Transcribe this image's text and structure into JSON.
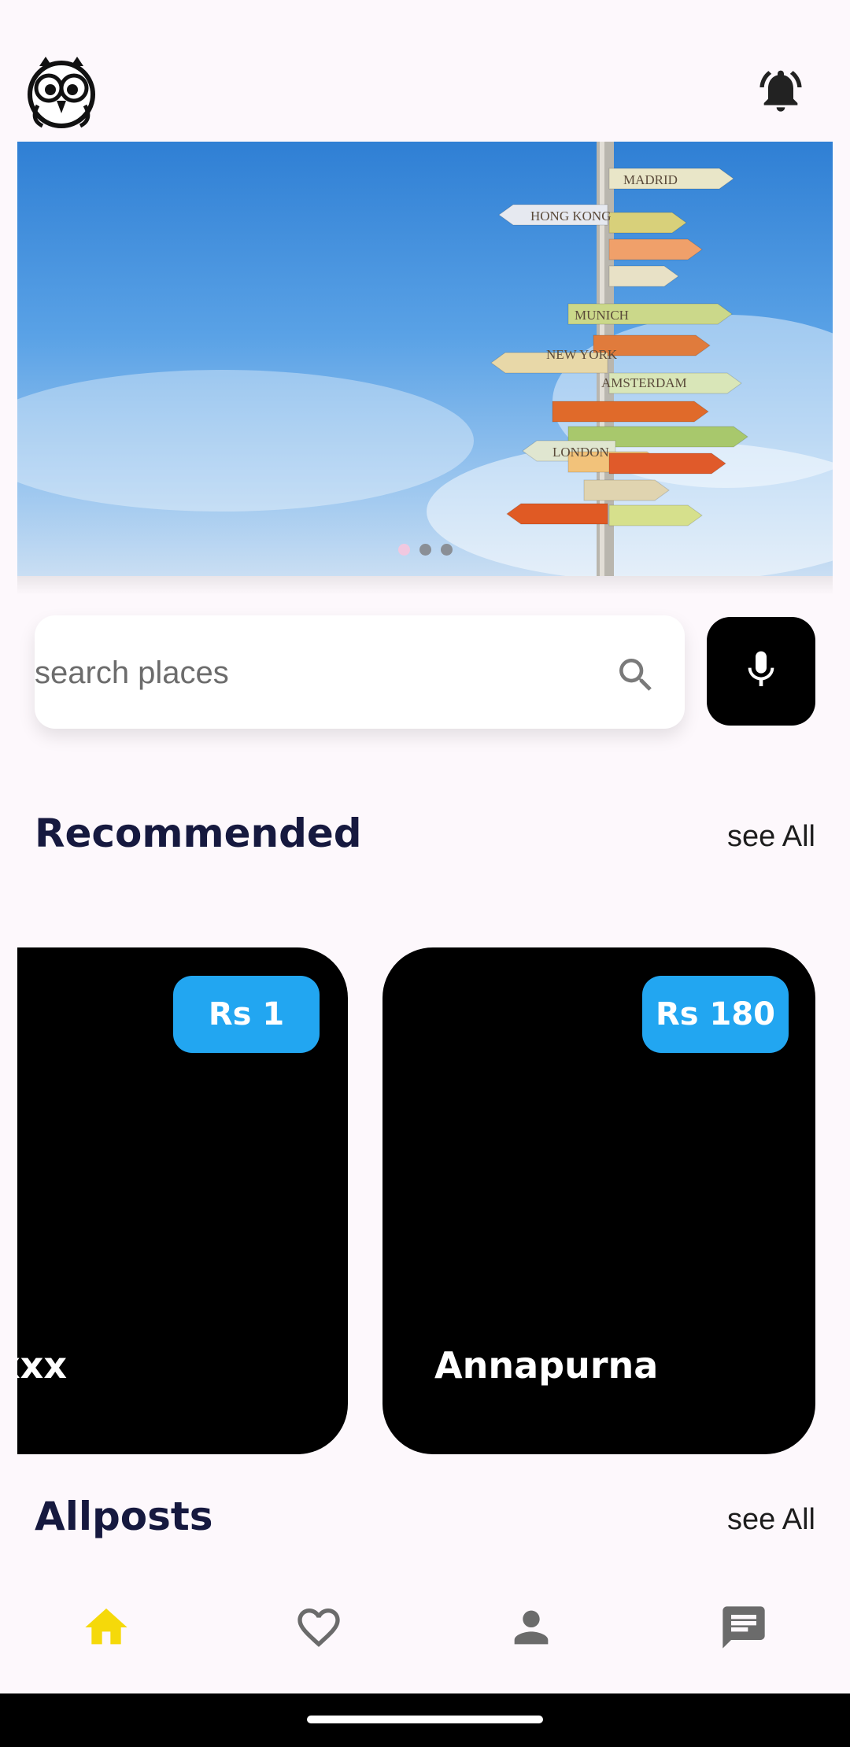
{
  "header": {
    "logo_icon": "owl-logo-icon",
    "bell_icon": "notification-bell-icon"
  },
  "banner": {
    "carousel": {
      "total": 3,
      "active_index": 0
    },
    "colors": {
      "active_dot": "#f1c8e0",
      "inactive_dot": "#8a8f96"
    },
    "sign_labels": [
      "MADRID",
      "HONG KONG",
      "MUNICH",
      "NEW YORK",
      "AMSTERDAM",
      "LONDON"
    ]
  },
  "search": {
    "placeholder": "search places",
    "value": "",
    "search_icon": "search-icon",
    "mic_icon": "microphone-icon"
  },
  "recommended": {
    "title": "Recommended",
    "see_all": "see All",
    "cards": [
      {
        "name": "xxx",
        "price": "Rs 1"
      },
      {
        "name": "Annapurna",
        "price": "Rs 180"
      }
    ],
    "colors": {
      "badge": "#22a6f1",
      "card": "#000000"
    }
  },
  "allposts": {
    "title": "Allposts",
    "see_all": "see All"
  },
  "nav": {
    "items": [
      {
        "icon": "home-icon",
        "active": true
      },
      {
        "icon": "heart-icon",
        "active": false
      },
      {
        "icon": "person-icon",
        "active": false
      },
      {
        "icon": "chat-icon",
        "active": false
      }
    ],
    "colors": {
      "active": "#f5d90a",
      "inactive": "#6b6b6b"
    }
  }
}
